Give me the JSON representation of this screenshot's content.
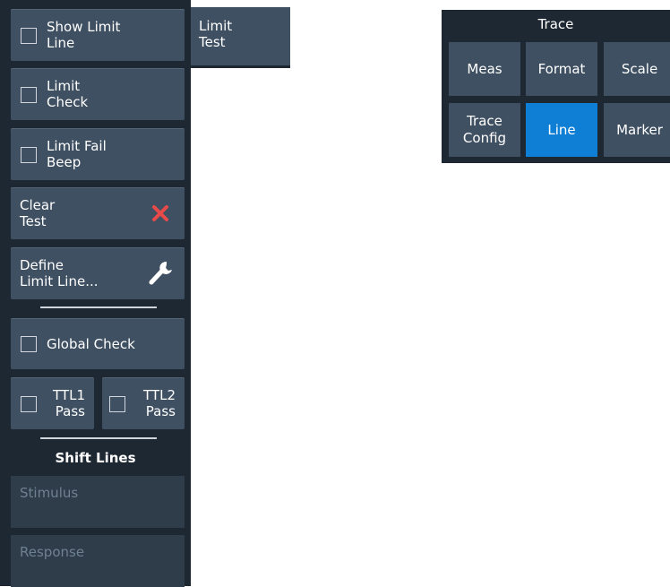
{
  "side": {
    "show_limit_line": "Show Limit\nLine",
    "limit_check": "Limit\nCheck",
    "limit_fail_beep": "Limit Fail\nBeep",
    "clear_test": "Clear\nTest",
    "define_limit_line": "Define\nLimit Line...",
    "global_check": "Global Check",
    "ttl1_pass": "TTL1\nPass",
    "ttl2_pass": "TTL2\nPass",
    "shift_lines": "Shift Lines",
    "stimulus_placeholder": "Stimulus",
    "response_placeholder": "Response"
  },
  "tab": {
    "limit_test": "Limit\nTest"
  },
  "trace": {
    "title": "Trace",
    "buttons": [
      "Meas",
      "Format",
      "Scale",
      "Trace\nConfig",
      "Line",
      "Marker"
    ],
    "active": "Line"
  },
  "colors": {
    "panel": "#1e2833",
    "button": "#3f5062",
    "active": "#0f7fd6",
    "clear_icon": "#e84a4a"
  },
  "icons": [
    "checkbox-icon",
    "close-icon",
    "wrench-icon"
  ]
}
